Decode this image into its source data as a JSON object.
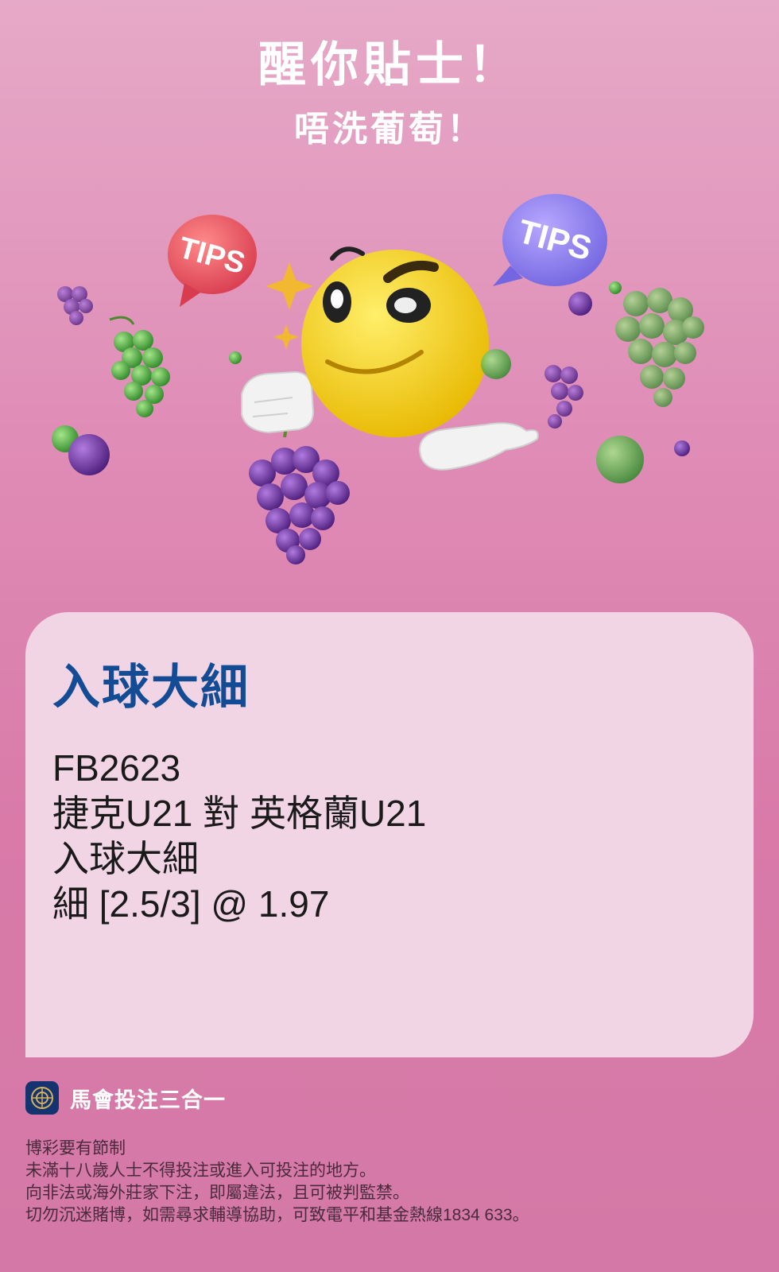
{
  "header": {
    "title": "醒你貼士！",
    "subtitle": "唔洗葡萄！"
  },
  "hero": {
    "left_bubble_text": "TIPS",
    "right_bubble_text": "TIPS"
  },
  "card": {
    "title": "入球大細",
    "lines": [
      "FB2623",
      "捷克U21 對 英格蘭U21",
      "入球大細",
      "細 [2.5/3] @ 1.97"
    ]
  },
  "brand": {
    "name": "馬會投注三合一"
  },
  "disclaimer": {
    "lines": [
      "博彩要有節制",
      "未滿十八歲人士不得投注或進入可投注的地方。",
      "向非法或海外莊家下注，即屬違法，且可被判監禁。",
      "切勿沉迷賭博，如需尋求輔導協助，可致電平和基金熱線1834 633。"
    ]
  },
  "colors": {
    "background": "#df8cb6",
    "card": "#f1d5e5",
    "title_blue": "#134c95",
    "brand_logo": "#15336f"
  }
}
